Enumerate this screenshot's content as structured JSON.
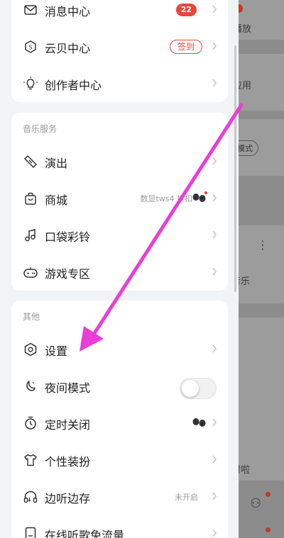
{
  "colors": {
    "accent": "#e8473c",
    "annotation_arrow": "#e93ed8"
  },
  "menu": {
    "top_items": [
      {
        "label": "消息中心",
        "icon": "mail-icon",
        "badge": "22"
      },
      {
        "label": "云贝中心",
        "icon": "coin-icon",
        "badge": "签到"
      },
      {
        "label": "创作者中心",
        "icon": "lightbulb-icon"
      }
    ],
    "music_section": {
      "title": "音乐服务",
      "items": [
        {
          "label": "演出",
          "icon": "ticket-icon"
        },
        {
          "label": "商城",
          "icon": "shopping-bag-icon",
          "note": "数显tws4 折扣"
        },
        {
          "label": "口袋彩铃",
          "icon": "music-note-icon"
        },
        {
          "label": "游戏专区",
          "icon": "gamepad-icon"
        }
      ]
    },
    "other_section": {
      "title": "其他",
      "items": [
        {
          "label": "设置",
          "icon": "settings-icon"
        },
        {
          "label": "夜间模式",
          "icon": "moon-icon"
        },
        {
          "label": "定时关闭",
          "icon": "timer-icon"
        },
        {
          "label": "个性装扮",
          "icon": "tshirt-icon"
        },
        {
          "label": "边听边存",
          "icon": "headphones-icon",
          "note": "未开启"
        },
        {
          "label": "在线听歌免流量",
          "icon": "sim-card-icon"
        }
      ]
    }
  },
  "background": {
    "texts": [
      "播放",
      "应用",
      "模式",
      "音乐",
      "村啦"
    ]
  }
}
